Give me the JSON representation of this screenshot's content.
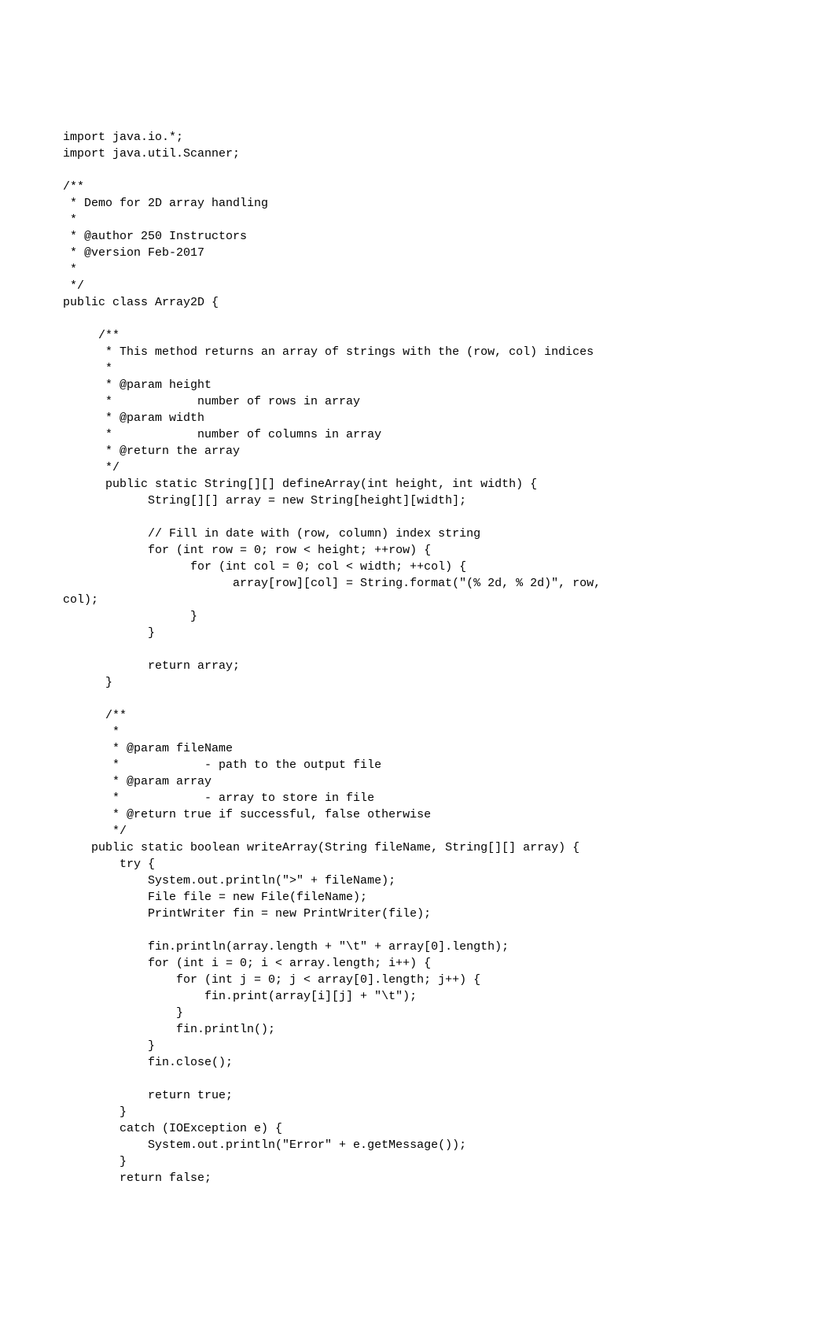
{
  "code": {
    "lines": [
      "import java.io.*;",
      "import java.util.Scanner;",
      "",
      "/**",
      " * Demo for 2D array handling",
      " *",
      " * @author 250 Instructors",
      " * @version Feb-2017",
      " *",
      " */",
      "public class Array2D {",
      "",
      "     /**",
      "      * This method returns an array of strings with the (row, col) indices",
      "      *",
      "      * @param height",
      "      *            number of rows in array",
      "      * @param width",
      "      *            number of columns in array",
      "      * @return the array",
      "      */",
      "      public static String[][] defineArray(int height, int width) {",
      "            String[][] array = new String[height][width];",
      "",
      "            // Fill in date with (row, column) index string",
      "            for (int row = 0; row < height; ++row) {",
      "                  for (int col = 0; col < width; ++col) {",
      "                        array[row][col] = String.format(\"(% 2d, % 2d)\", row,",
      "col);",
      "                  }",
      "            }",
      "",
      "            return array;",
      "      }",
      "",
      "      /**",
      "       *",
      "       * @param fileName",
      "       *            - path to the output file",
      "       * @param array",
      "       *            - array to store in file",
      "       * @return true if successful, false otherwise",
      "       */",
      "    public static boolean writeArray(String fileName, String[][] array) {",
      "        try {",
      "            System.out.println(\">\" + fileName);",
      "            File file = new File(fileName);",
      "            PrintWriter fin = new PrintWriter(file);",
      "",
      "            fin.println(array.length + \"\\t\" + array[0].length);",
      "            for (int i = 0; i < array.length; i++) {",
      "                for (int j = 0; j < array[0].length; j++) {",
      "                    fin.print(array[i][j] + \"\\t\");",
      "                }",
      "                fin.println();",
      "            }",
      "            fin.close();",
      "",
      "            return true;",
      "        }",
      "        catch (IOException e) {",
      "            System.out.println(\"Error\" + e.getMessage());",
      "        }",
      "        return false;"
    ]
  }
}
